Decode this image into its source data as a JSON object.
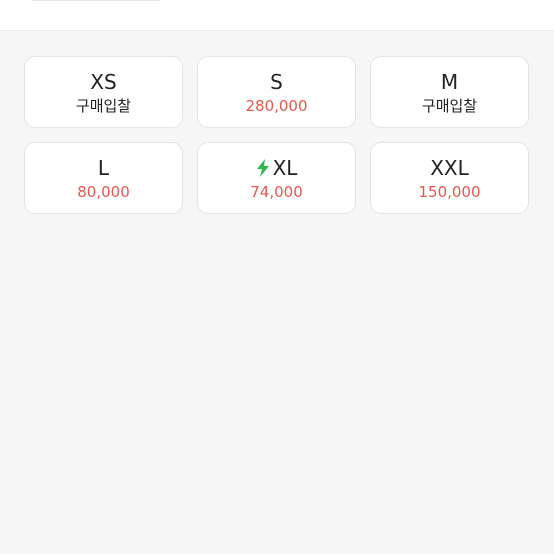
{
  "colors": {
    "background": "#f6f6f6",
    "card": "#ffffff",
    "price": "#e05a50",
    "bid": "#222222",
    "fast_delivery": "#2db74b"
  },
  "sizes": [
    {
      "size": "XS",
      "value": "구매입찰",
      "type": "bid",
      "fast_delivery": false
    },
    {
      "size": "S",
      "value": "280,000",
      "type": "price",
      "fast_delivery": false
    },
    {
      "size": "M",
      "value": "구매입찰",
      "type": "bid",
      "fast_delivery": false
    },
    {
      "size": "L",
      "value": "80,000",
      "type": "price",
      "fast_delivery": false
    },
    {
      "size": "XL",
      "value": "74,000",
      "type": "price",
      "fast_delivery": true,
      "icon": "lightning-bolt-icon"
    },
    {
      "size": "XXL",
      "value": "150,000",
      "type": "price",
      "fast_delivery": false
    }
  ]
}
